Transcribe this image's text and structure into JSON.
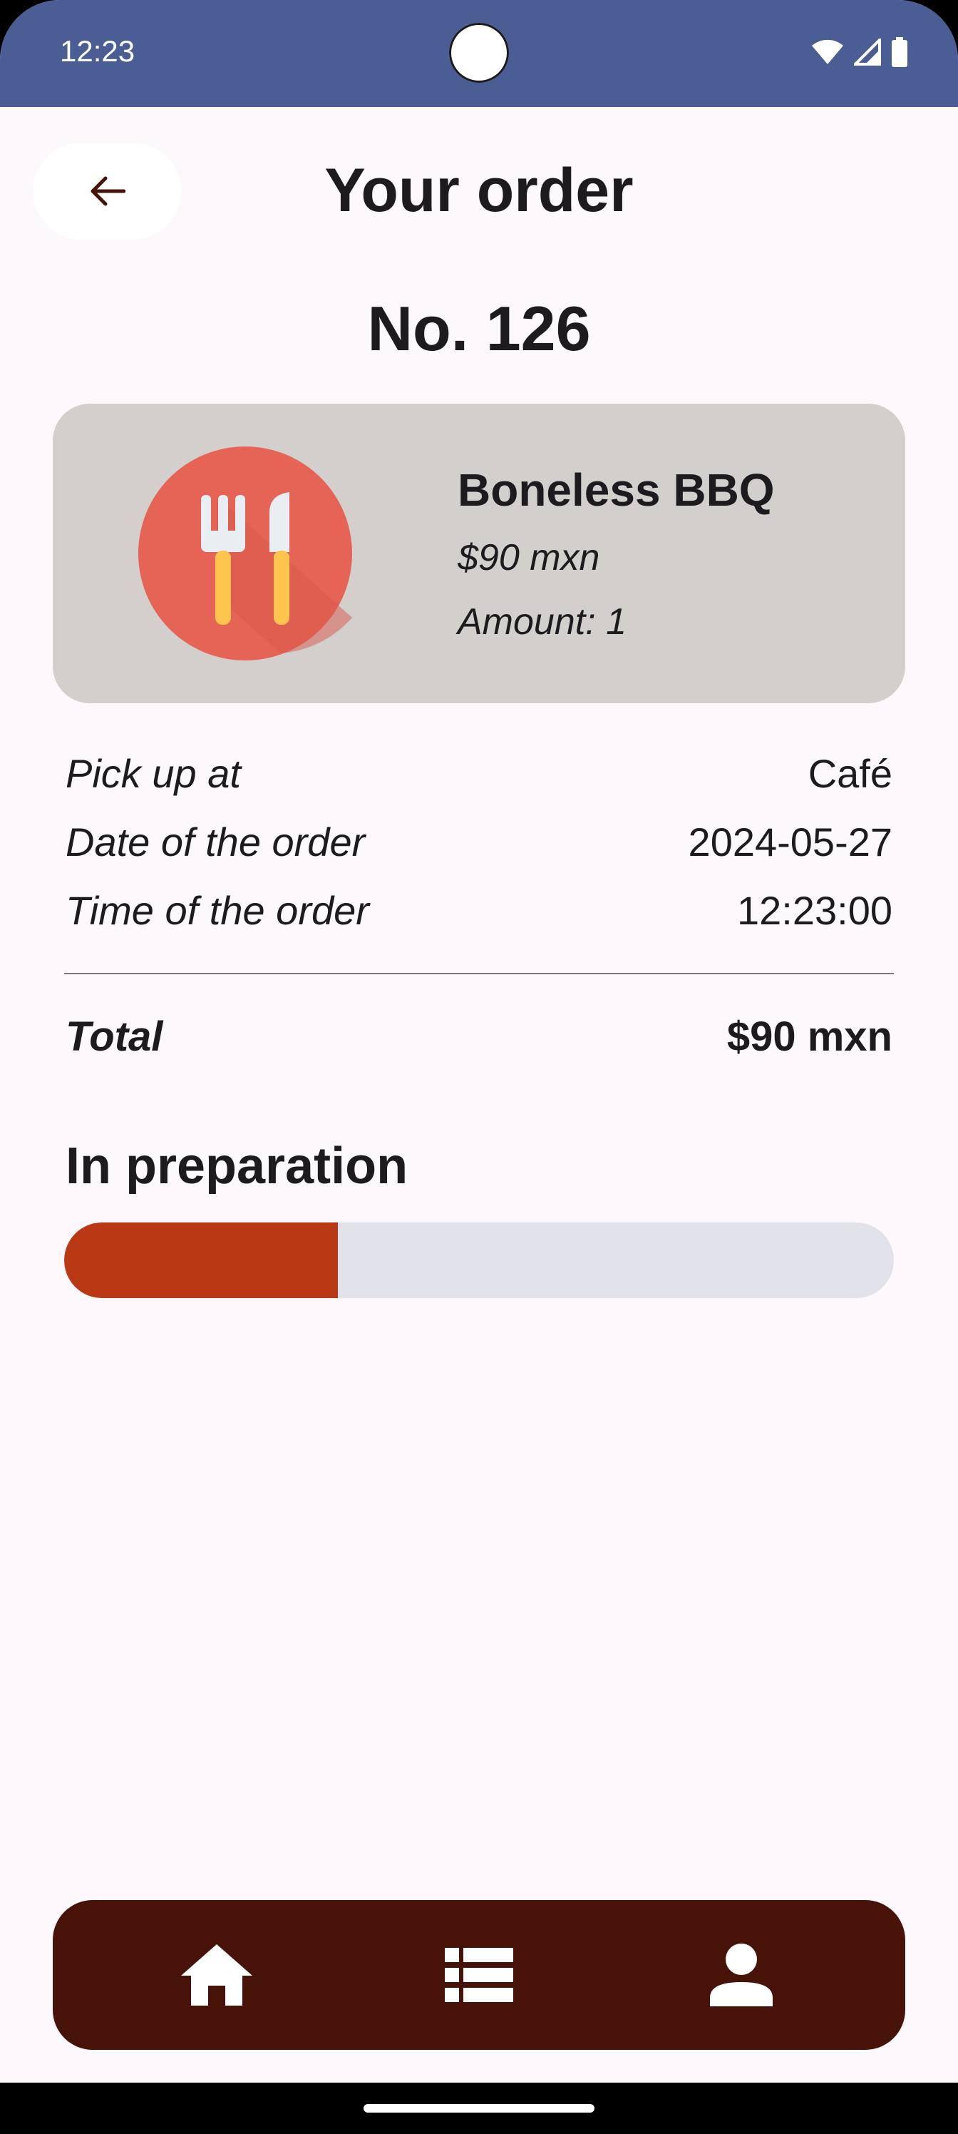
{
  "status_bar": {
    "time": "12:23",
    "icons": [
      "wifi-icon",
      "signal-icon",
      "battery-icon"
    ]
  },
  "header": {
    "title": "Your order",
    "back_icon": "arrow-back-icon"
  },
  "order": {
    "number": "No. 126"
  },
  "product": {
    "name": "Boneless BBQ",
    "price": "$90 mxn",
    "amount": "Amount: 1",
    "icon": "fork-knife-icon"
  },
  "details": [
    {
      "label": "Pick up at",
      "value": "Café"
    },
    {
      "label": "Date of the order",
      "value": "2024-05-27"
    },
    {
      "label": "Time of the order",
      "value": "12:23:00"
    }
  ],
  "total": {
    "label": "Total",
    "value": "$90 mxn"
  },
  "status": {
    "label": "In preparation",
    "progress_fraction": 0.33
  },
  "bottom_nav": {
    "items": [
      "home-icon",
      "list-icon",
      "person-icon"
    ]
  },
  "colors": {
    "status_bar": "#4a5d95",
    "background": "#fcf8fb",
    "card": "#d3cfcd",
    "progress_fill": "#b93915",
    "progress_track": "#e2e2ea",
    "nav_background": "#471309",
    "back_arrow": "#471309"
  }
}
